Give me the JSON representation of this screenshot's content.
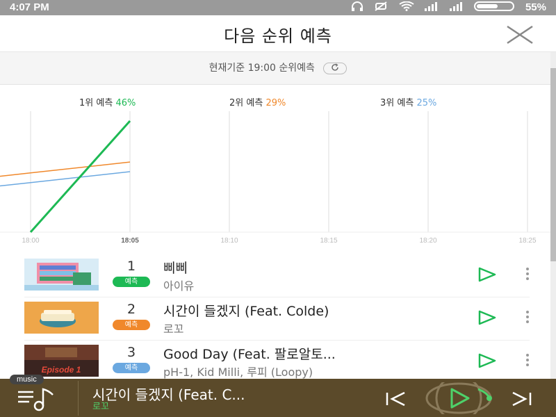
{
  "status_bar": {
    "time": "4:07 PM",
    "battery": "55%"
  },
  "header": {
    "title": "다음 순위 예측"
  },
  "subbar": {
    "text": "현재기준 19:00 순위예측"
  },
  "predictions": [
    {
      "label": "1위 예측",
      "percent": "46%",
      "color": "#1db954"
    },
    {
      "label": "2위 예측",
      "percent": "29%",
      "color": "#f0882b"
    },
    {
      "label": "3위 예측",
      "percent": "25%",
      "color": "#6ba8e0"
    }
  ],
  "chart_data": {
    "type": "line",
    "x": [
      "18:00",
      "18:05",
      "18:10",
      "18:15",
      "18:20",
      "18:25"
    ],
    "grid": true,
    "series": [
      {
        "rank": 1,
        "color": "#1db954",
        "values": [
          0,
          46
        ]
      },
      {
        "rank": 2,
        "color": "#f0882b",
        "values": [
          24.5,
          29
        ]
      },
      {
        "rank": 3,
        "color": "#6ba8e0",
        "values": [
          20.5,
          25
        ]
      }
    ]
  },
  "chart_list": [
    {
      "rank": "1",
      "badge": "예측",
      "badge_color": "#1db954",
      "title": "삐삐",
      "artist": "아이유"
    },
    {
      "rank": "2",
      "badge": "예측",
      "badge_color": "#f0882b",
      "title": "시간이 들겠지 (Feat. Colde)",
      "artist": "로꼬"
    },
    {
      "rank": "3",
      "badge": "예측",
      "badge_color": "#6ba8e0",
      "title": "Good Day (Feat. 팔로알토...",
      "artist": "pH-1, Kid Milli, 루피 (Loopy)"
    }
  ],
  "album_art_text": {
    "rank3": "Episode 1"
  },
  "mini_player": {
    "tag": "music",
    "title": "시간이 들겠지 (Feat. C...",
    "artist": "로꼬",
    "accent": "#4ed16a"
  }
}
